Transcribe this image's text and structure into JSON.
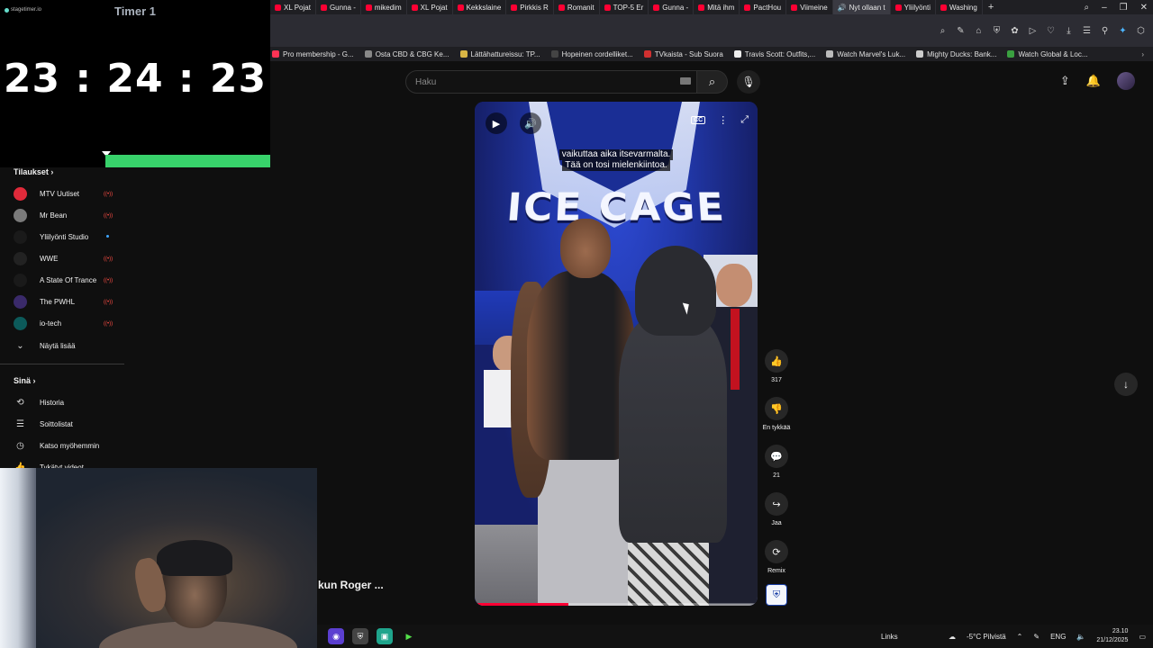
{
  "timer": {
    "brand": "stagetimer.io",
    "title": "Timer 1",
    "value": "23 : 24 : 23",
    "progress_fraction": 0.61
  },
  "browser": {
    "tabs": [
      {
        "label": "XL Pojat"
      },
      {
        "label": "Gunna -"
      },
      {
        "label": "mikedim"
      },
      {
        "label": "XL Pojat"
      },
      {
        "label": "Kekkslaine"
      },
      {
        "label": "Pirkkis R"
      },
      {
        "label": "Romanit"
      },
      {
        "label": "TOP-5 Er"
      },
      {
        "label": "Gunna -"
      },
      {
        "label": "Mitä ihm"
      },
      {
        "label": "PactHou"
      },
      {
        "label": "Viimeine"
      },
      {
        "label": "Nyt ollaan t"
      },
      {
        "label": "Yliilyönti"
      },
      {
        "label": "Washing"
      }
    ],
    "new_tab": "+",
    "bookmarks": [
      {
        "label": "Pro membership - G..."
      },
      {
        "label": "Osta CBD & CBG Ke..."
      },
      {
        "label": "Lättähattureissu: TP..."
      },
      {
        "label": "Hopeinen cordelliket..."
      },
      {
        "label": "TVkaista - Sub Suora"
      },
      {
        "label": "Travis Scott: Outfits,..."
      },
      {
        "label": "Watch Marvel's Luk..."
      },
      {
        "label": "Mighty Ducks: Bank..."
      },
      {
        "label": "Watch Global & Loc..."
      }
    ]
  },
  "header": {
    "search_placeholder": "Haku"
  },
  "sidebar": {
    "subscriptions_title": "Tilaukset",
    "subscriptions": [
      {
        "label": "MTV Uutiset",
        "color": "#e02a3a"
      },
      {
        "label": "Mr Bean",
        "color": "#7a7a7a"
      },
      {
        "label": "Yliilyönti Studio",
        "color": "#1a1a1a"
      },
      {
        "label": "WWE",
        "color": "#222222"
      },
      {
        "label": "A State Of Trance",
        "color": "#1a1a1a"
      },
      {
        "label": "The PWHL",
        "color": "#3a2a6a"
      },
      {
        "label": "io-tech",
        "color": "#0c5a5a"
      }
    ],
    "show_more": "Näytä lisää",
    "you_title": "Sinä",
    "you_items": [
      {
        "label": "Historia",
        "icon": "history-icon"
      },
      {
        "label": "Soittolistat",
        "icon": "playlists-icon"
      },
      {
        "label": "Katso myöhemmin",
        "icon": "watch-later-icon"
      },
      {
        "label": "Tykätyt videot",
        "icon": "liked-videos-icon"
      }
    ]
  },
  "partial_title": "kun Roger ...",
  "short": {
    "captions": [
      "vaikuttaa aika itsevarmalta.",
      "Tää on tosi mielenkiintoa."
    ],
    "banner_text": "ICE CAGE",
    "cc_label": "CC",
    "progress_fraction": 0.33
  },
  "actions": [
    {
      "name": "like",
      "icon": "thumbs-up-icon",
      "label": "317"
    },
    {
      "name": "dislike",
      "icon": "thumbs-down-icon",
      "label": "En tykkää"
    },
    {
      "name": "comments",
      "icon": "comments-icon",
      "label": "21"
    },
    {
      "name": "share",
      "icon": "share-icon",
      "label": "Jaa"
    },
    {
      "name": "remix",
      "icon": "remix-icon",
      "label": "Remix"
    }
  ],
  "taskbar": {
    "links_label": "Links",
    "weather": "-5°C  Pilvistä",
    "language": "ENG",
    "time": "23.10",
    "date": "21/12/2025"
  }
}
